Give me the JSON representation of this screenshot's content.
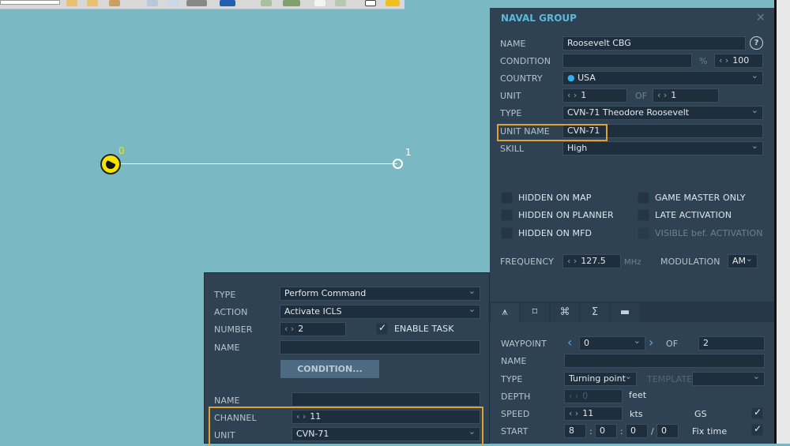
{
  "toolbar": {
    "icons": [
      "flag-icon",
      "flag-icon",
      "edit-icon",
      "zoom-icon",
      "zoom-fit-icon",
      "select-icon",
      "undo-icon",
      "add-icon",
      "vehicle-icon",
      "page-icon",
      "page-icon",
      "text-icon",
      "comment-icon"
    ]
  },
  "map": {
    "waypoints": [
      {
        "label": "0"
      },
      {
        "label": "1"
      }
    ]
  },
  "group": {
    "title": "NAVAL GROUP",
    "close": "×",
    "help": "?",
    "name_label": "NAME",
    "name": "Roosevelt CBG",
    "condition_label": "CONDITION",
    "condition": "",
    "percent": "%",
    "probability": "100",
    "country_label": "COUNTRY",
    "country": "USA",
    "unit_label": "UNIT",
    "unit": "1",
    "of": "OF",
    "unit_total": "1",
    "type_label": "TYPE",
    "type": "CVN-71 Theodore Roosevelt",
    "unit_name_label": "UNIT NAME",
    "unit_name": "CVN-71",
    "skill_label": "SKILL",
    "skill": "High",
    "checks": [
      {
        "label": "HIDDEN ON MAP",
        "checked": false
      },
      {
        "label": "HIDDEN ON PLANNER",
        "checked": false
      },
      {
        "label": "HIDDEN ON MFD",
        "checked": false
      },
      {
        "label": "GAME MASTER ONLY",
        "checked": false
      },
      {
        "label": "LATE ACTIVATION",
        "checked": false
      },
      {
        "label": "VISIBLE bef. ACTIVATION",
        "checked": false
      }
    ],
    "frequency_label": "FREQUENCY",
    "frequency": "127.5",
    "mhz": "MHz",
    "modulation_label": "MODULATION",
    "modulation": "AM",
    "colors": {
      "accent": "#5fb8d8",
      "highlight": "#e2a030"
    }
  },
  "route": {
    "tabs": [
      "⩚",
      "⌑",
      "⌘",
      "Σ",
      "▬"
    ],
    "waypoint_label": "WAYPOINT",
    "waypoint": "0",
    "of": "OF",
    "waypoint_total": "2",
    "name_label": "NAME",
    "name": "",
    "type_label": "TYPE",
    "type": "Turning point",
    "template_label": "TEMPLATE",
    "template": "",
    "depth_label": "DEPTH",
    "depth": "0",
    "feet": "feet",
    "speed_label": "SPEED",
    "speed": "11",
    "kts": "kts",
    "gs": "GS",
    "start_label": "START",
    "start_h": "8",
    "start_m": "0",
    "start_s": "0",
    "start_d": "0",
    "fix_time": "Fix time"
  },
  "task": {
    "type_label": "TYPE",
    "type": "Perform Command",
    "action_label": "ACTION",
    "action": "Activate ICLS",
    "number_label": "NUMBER",
    "number": "2",
    "enable_task": "ENABLE TASK",
    "name_label": "NAME",
    "name": "",
    "condition_button": "CONDITION...",
    "name2_label": "NAME",
    "name2": "",
    "channel_label": "CHANNEL",
    "channel": "11",
    "unit_label": "UNIT",
    "unit": "CVN-71"
  }
}
